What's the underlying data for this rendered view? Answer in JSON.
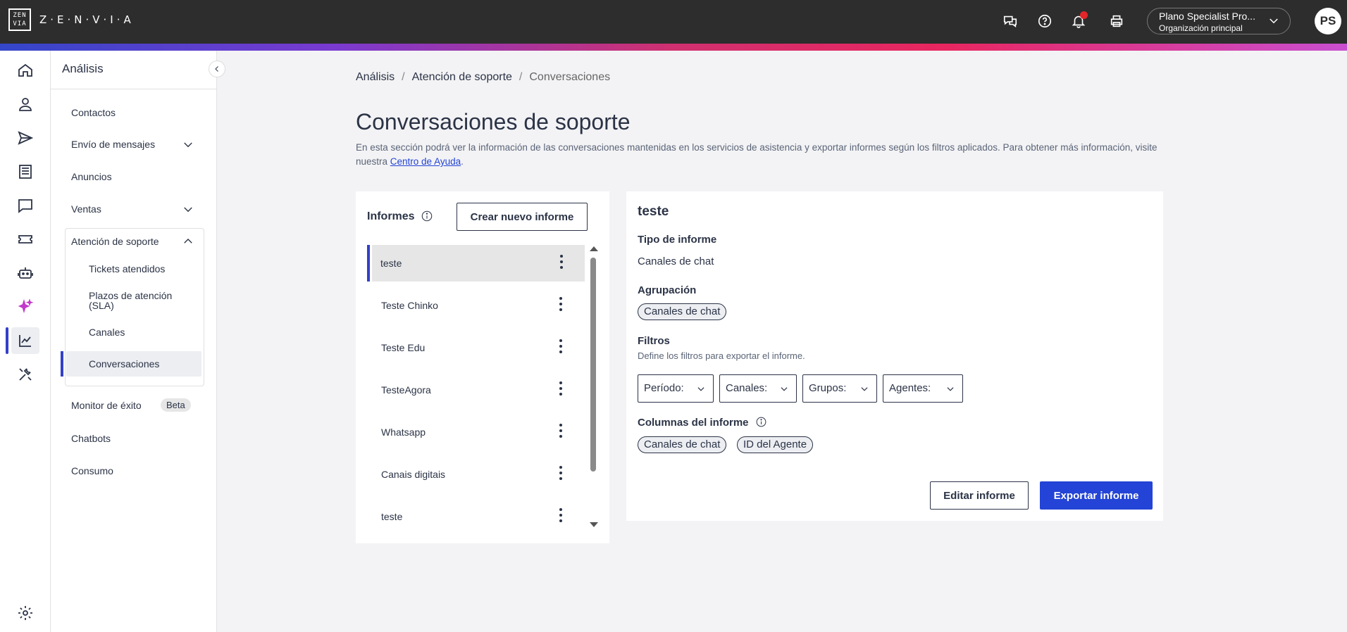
{
  "brand": {
    "logo_mark": "ZEN VIA",
    "logo_text": "Z·E·N·V·I·A"
  },
  "header": {
    "icons": [
      "chat-bubbles-icon",
      "help-icon",
      "bell-icon",
      "printer-icon"
    ],
    "org_name": "Plano Specialist Pro...",
    "org_sub": "Organización principal",
    "avatar_initials": "PS"
  },
  "rail": {
    "items": [
      "home-icon",
      "user-icon",
      "send-icon",
      "document-icon",
      "chat-icon",
      "ticket-icon",
      "bot-icon",
      "sparkle-icon",
      "analytics-icon",
      "tools-icon",
      "settings-icon"
    ],
    "active": "analytics-icon"
  },
  "sidebar": {
    "title": "Análisis",
    "items": {
      "contacts": "Contactos",
      "messaging": "Envío de mensajes",
      "ads": "Anuncios",
      "sales": "Ventas",
      "support": "Atención de soporte",
      "success_monitor": "Monitor de éxito",
      "beta": "Beta",
      "chatbots": "Chatbots",
      "consumption": "Consumo"
    },
    "support_sub": {
      "tickets": "Tickets atendidos",
      "sla": "Plazos de atención (SLA)",
      "channels": "Canales",
      "conversations": "Conversaciones"
    }
  },
  "breadcrumb": {
    "b1": "Análisis",
    "b2": "Atención de soporte",
    "b3": "Conversaciones",
    "sep": "/"
  },
  "page": {
    "title": "Conversaciones de soporte",
    "desc_prefix": "En esta sección podrá ver la información de las conversaciones mantenidas en los servicios de asistencia y exportar informes según los filtros aplicados. Para obtener más información, visite nuestra ",
    "desc_link": "Centro de Ayuda",
    "desc_suffix": "."
  },
  "reports": {
    "title": "Informes",
    "new_button": "Crear nuevo informe",
    "items": [
      "teste",
      "Teste Chinko",
      "Teste Edu",
      "TesteAgora",
      "Whatsapp",
      "Canais digitais",
      "teste"
    ],
    "selected_index": 0
  },
  "detail": {
    "title": "teste",
    "type_label": "Tipo de informe",
    "type_value": "Canales de chat",
    "grouping_label": "Agrupación",
    "grouping_chip": "Canales de chat",
    "filters_label": "Filtros",
    "filters_sub": "Define los filtros para exportar el informe.",
    "filters": {
      "period": "Período:",
      "channels": "Canales:",
      "groups": "Grupos:",
      "agents": "Agentes:"
    },
    "columns_label": "Columnas del informe",
    "columns": {
      "c1": "Canales de chat",
      "c2": "ID del Agente"
    },
    "edit_button": "Editar informe",
    "export_button": "Exportar informe"
  }
}
